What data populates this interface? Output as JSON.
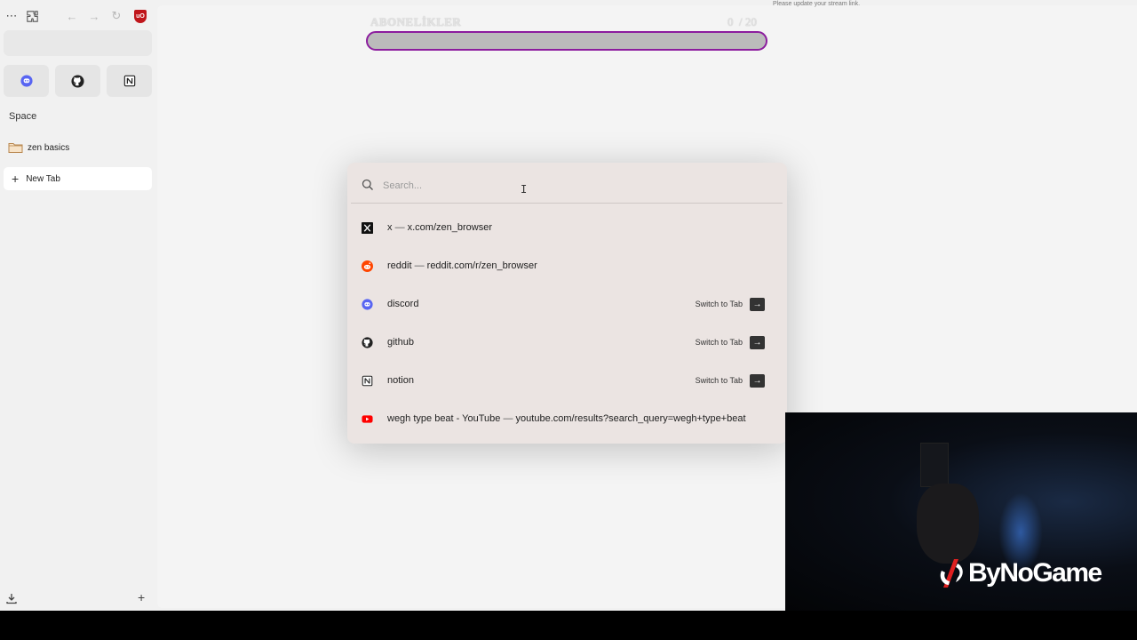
{
  "overlay": {
    "title": "ABONELİKLER",
    "counter_current": "0",
    "counter_total": "/ 20",
    "progress_fraction": 0,
    "progress_color": "#8c1d9e",
    "stream_notice": "Please update your stream link."
  },
  "sidebar": {
    "space_label": "Space",
    "folder_label": "zen basics",
    "new_tab_label": "New Tab",
    "pinned": [
      {
        "name": "discord",
        "icon": "discord-icon"
      },
      {
        "name": "github",
        "icon": "github-icon"
      },
      {
        "name": "notion",
        "icon": "notion-icon"
      }
    ]
  },
  "palette": {
    "search_placeholder": "Search...",
    "switch_label": "Switch to Tab",
    "results": [
      {
        "title": "x",
        "sep": "—",
        "url": "x.com/zen_browser",
        "icon": "x-icon",
        "switch": false
      },
      {
        "title": "reddit",
        "sep": "—",
        "url": "reddit.com/r/zen_browser",
        "icon": "reddit-icon",
        "switch": false
      },
      {
        "title": "discord",
        "sep": "",
        "url": "",
        "icon": "discord-icon",
        "switch": true
      },
      {
        "title": "github",
        "sep": "",
        "url": "",
        "icon": "github-icon",
        "switch": true
      },
      {
        "title": "notion",
        "sep": "",
        "url": "",
        "icon": "notion-icon",
        "switch": true
      },
      {
        "title": "wegh type beat - YouTube",
        "sep": "—",
        "url": "youtube.com/results?search_query=wegh+type+beat",
        "icon": "youtube-icon",
        "switch": false
      }
    ]
  },
  "webcam": {
    "logo_text": "ByNoGame"
  },
  "colors": {
    "discord": "#5865f2",
    "reddit": "#ff4500",
    "youtube": "#ff0000",
    "ublock": "#c0161b"
  }
}
